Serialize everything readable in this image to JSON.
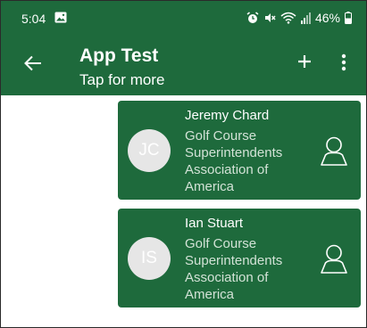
{
  "status_bar": {
    "time": "5:04",
    "battery": "46%",
    "icons": [
      "image-icon",
      "alarm-icon",
      "mute-icon",
      "wifi-icon",
      "signal-icon",
      "battery-icon"
    ]
  },
  "app_bar": {
    "title": "App Test",
    "subtitle": "Tap for more",
    "icons": [
      "back-arrow-icon",
      "plus-icon",
      "more-vertical-icon"
    ]
  },
  "contacts": [
    {
      "initials": "JC",
      "name": "Jeremy Chard",
      "organization": "Golf Course Superintendents Association of America"
    },
    {
      "initials": "IS",
      "name": "Ian Stuart",
      "organization": "Golf Course Superintendents Association of America"
    }
  ],
  "colors": {
    "brand_green": "#1e6a3c",
    "avatar_bg": "#e6e6e6",
    "secondary_text": "#d2e2d6"
  }
}
